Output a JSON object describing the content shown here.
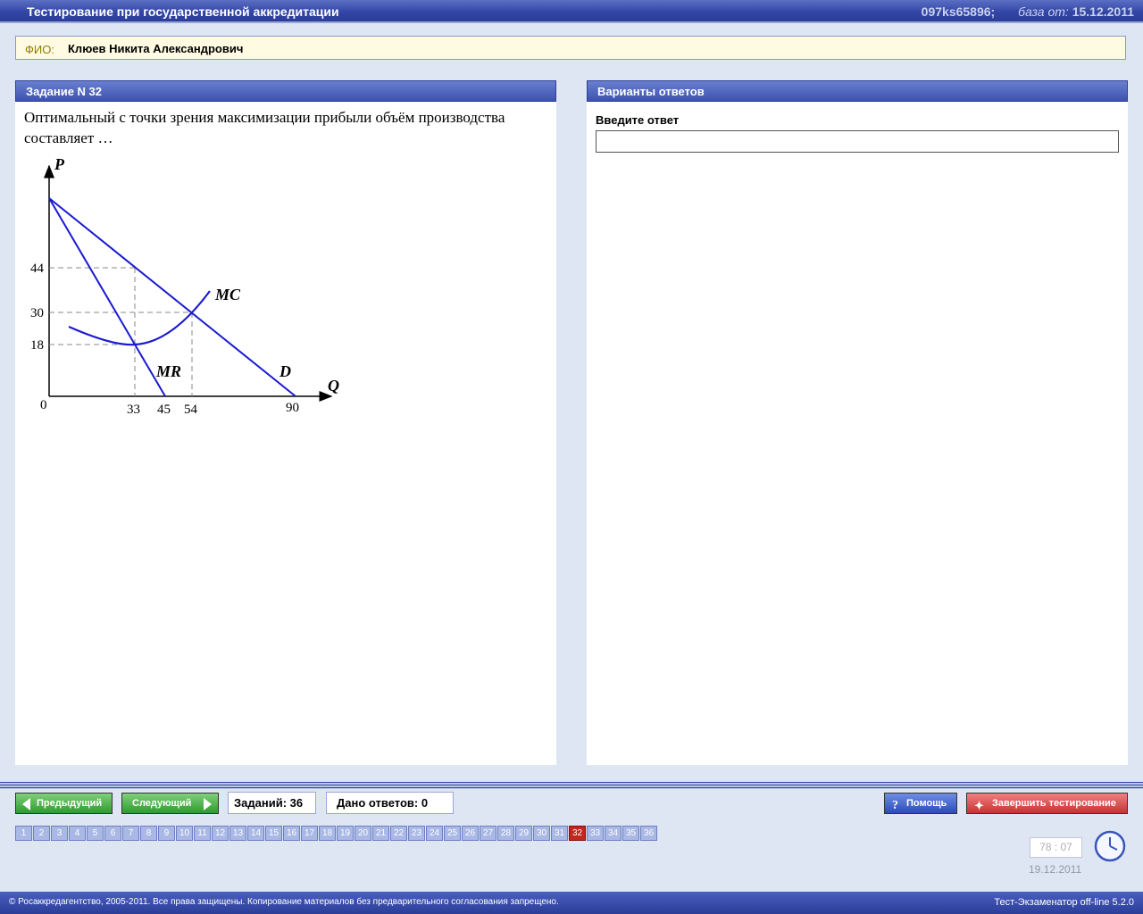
{
  "header": {
    "app_title": "Тестирование при государственной аккредитации",
    "session_id": "097ks65896;",
    "db_label": "база от:",
    "db_date": "15.12.2011"
  },
  "student": {
    "label": "ФИО:",
    "name": "Клюев Никита Александрович"
  },
  "task_panel": {
    "title": "Задание N 32",
    "question": "Оптимальный с точки зрения максимизации прибыли объём производства составляет …"
  },
  "graph": {
    "axis_p": "P",
    "axis_q": "Q",
    "origin": "0",
    "y_ticks": [
      "44",
      "30",
      "18"
    ],
    "x_ticks": [
      "33",
      "45",
      "54",
      "90"
    ],
    "curve_mc": "MC",
    "curve_mr": "MR",
    "curve_d": "D"
  },
  "answer_panel": {
    "title": "Варианты ответов",
    "prompt": "Введите ответ",
    "value": ""
  },
  "controls": {
    "prev": "Предыдущий",
    "next": "Следующий",
    "tasks_total": "Заданий: 36",
    "answers_given": "Дано ответов: 0",
    "help": "Помощь",
    "finish": "Завершить тестирование"
  },
  "nav": {
    "numbers": [
      "1",
      "2",
      "3",
      "4",
      "5",
      "6",
      "7",
      "8",
      "9",
      "10",
      "11",
      "12",
      "13",
      "14",
      "15",
      "16",
      "17",
      "18",
      "19",
      "20",
      "21",
      "22",
      "23",
      "24",
      "25",
      "26",
      "27",
      "28",
      "29",
      "30",
      "31",
      "32",
      "33",
      "34",
      "35",
      "36"
    ],
    "current": "32"
  },
  "status": {
    "timer": "78 : 07",
    "date": "19.12.2011"
  },
  "footer": {
    "copyright": "© Росаккредагентство, 2005-2011. Все права защищены. Копирование материалов без предварительного согласования запрещено.",
    "version": "Тест-Экзаменатор off-line 5.2.0"
  },
  "colors": {
    "accent": "#3446a6",
    "active_nav": "#c0281e",
    "curve": "#1a1ad0"
  }
}
